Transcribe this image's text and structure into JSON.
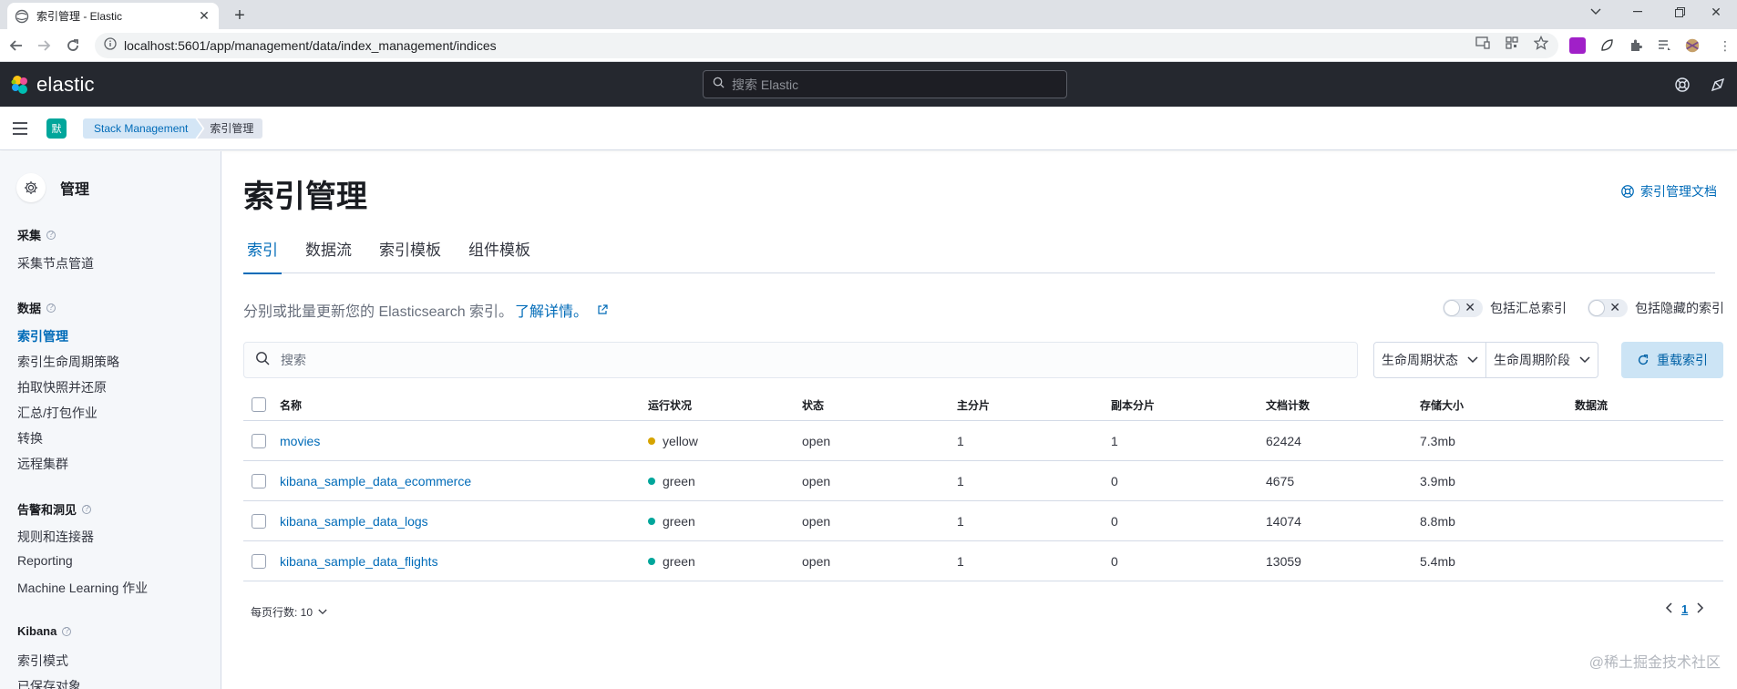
{
  "browser": {
    "tab_title": "索引管理 - Elastic",
    "url": "localhost:5601/app/management/data/index_management/indices"
  },
  "kibana": {
    "brand": "elastic",
    "search_placeholder": "搜索 Elastic",
    "space_initial": "默",
    "breadcrumbs": [
      "Stack Management",
      "索引管理"
    ]
  },
  "sidenav": {
    "title": "管理",
    "groups": [
      {
        "label": "采集",
        "items": [
          "采集节点管道"
        ]
      },
      {
        "label": "数据",
        "items": [
          "索引管理",
          "索引生命周期策略",
          "拍取快照并还原",
          "汇总/打包作业",
          "转换",
          "远程集群"
        ]
      },
      {
        "label": "告警和洞见",
        "items": [
          "规则和连接器",
          "Reporting",
          "Machine Learning 作业"
        ]
      },
      {
        "label": "Kibana",
        "items": [
          "索引模式",
          "已保存对象"
        ]
      }
    ],
    "active_item": "索引管理"
  },
  "main": {
    "title": "索引管理",
    "doc_link": "索引管理文档",
    "tabs": [
      "索引",
      "数据流",
      "索引模板",
      "组件模板"
    ],
    "active_tab": "索引",
    "description": "分别或批量更新您的 Elasticsearch 索引。",
    "learn_more": "了解详情。",
    "toggle_rollup": "包括汇总索引",
    "toggle_hidden": "包括隐藏的索引",
    "search_placeholder": "搜索",
    "filter_lifecycle_status": "生命周期状态",
    "filter_lifecycle_phase": "生命周期阶段",
    "reload_button": "重载索引",
    "columns": [
      "名称",
      "运行状况",
      "状态",
      "主分片",
      "副本分片",
      "文档计数",
      "存储大小",
      "数据流"
    ],
    "rows": [
      {
        "name": "movies",
        "health": "yellow",
        "status": "open",
        "primary": "1",
        "replicas": "1",
        "docs": "62424",
        "size": "7.3mb"
      },
      {
        "name": "kibana_sample_data_ecommerce",
        "health": "green",
        "status": "open",
        "primary": "1",
        "replicas": "0",
        "docs": "4675",
        "size": "3.9mb"
      },
      {
        "name": "kibana_sample_data_logs",
        "health": "green",
        "status": "open",
        "primary": "1",
        "replicas": "0",
        "docs": "14074",
        "size": "8.8mb"
      },
      {
        "name": "kibana_sample_data_flights",
        "health": "green",
        "status": "open",
        "primary": "1",
        "replicas": "0",
        "docs": "13059",
        "size": "5.4mb"
      }
    ],
    "rows_per_page": "每页行数: 10",
    "current_page": "1"
  },
  "colors": {
    "accent": "#006bb8",
    "yellow": "#d6a400",
    "green": "#00a69b",
    "header_bg": "#25282f"
  },
  "watermark": "@稀土掘金技术社区"
}
